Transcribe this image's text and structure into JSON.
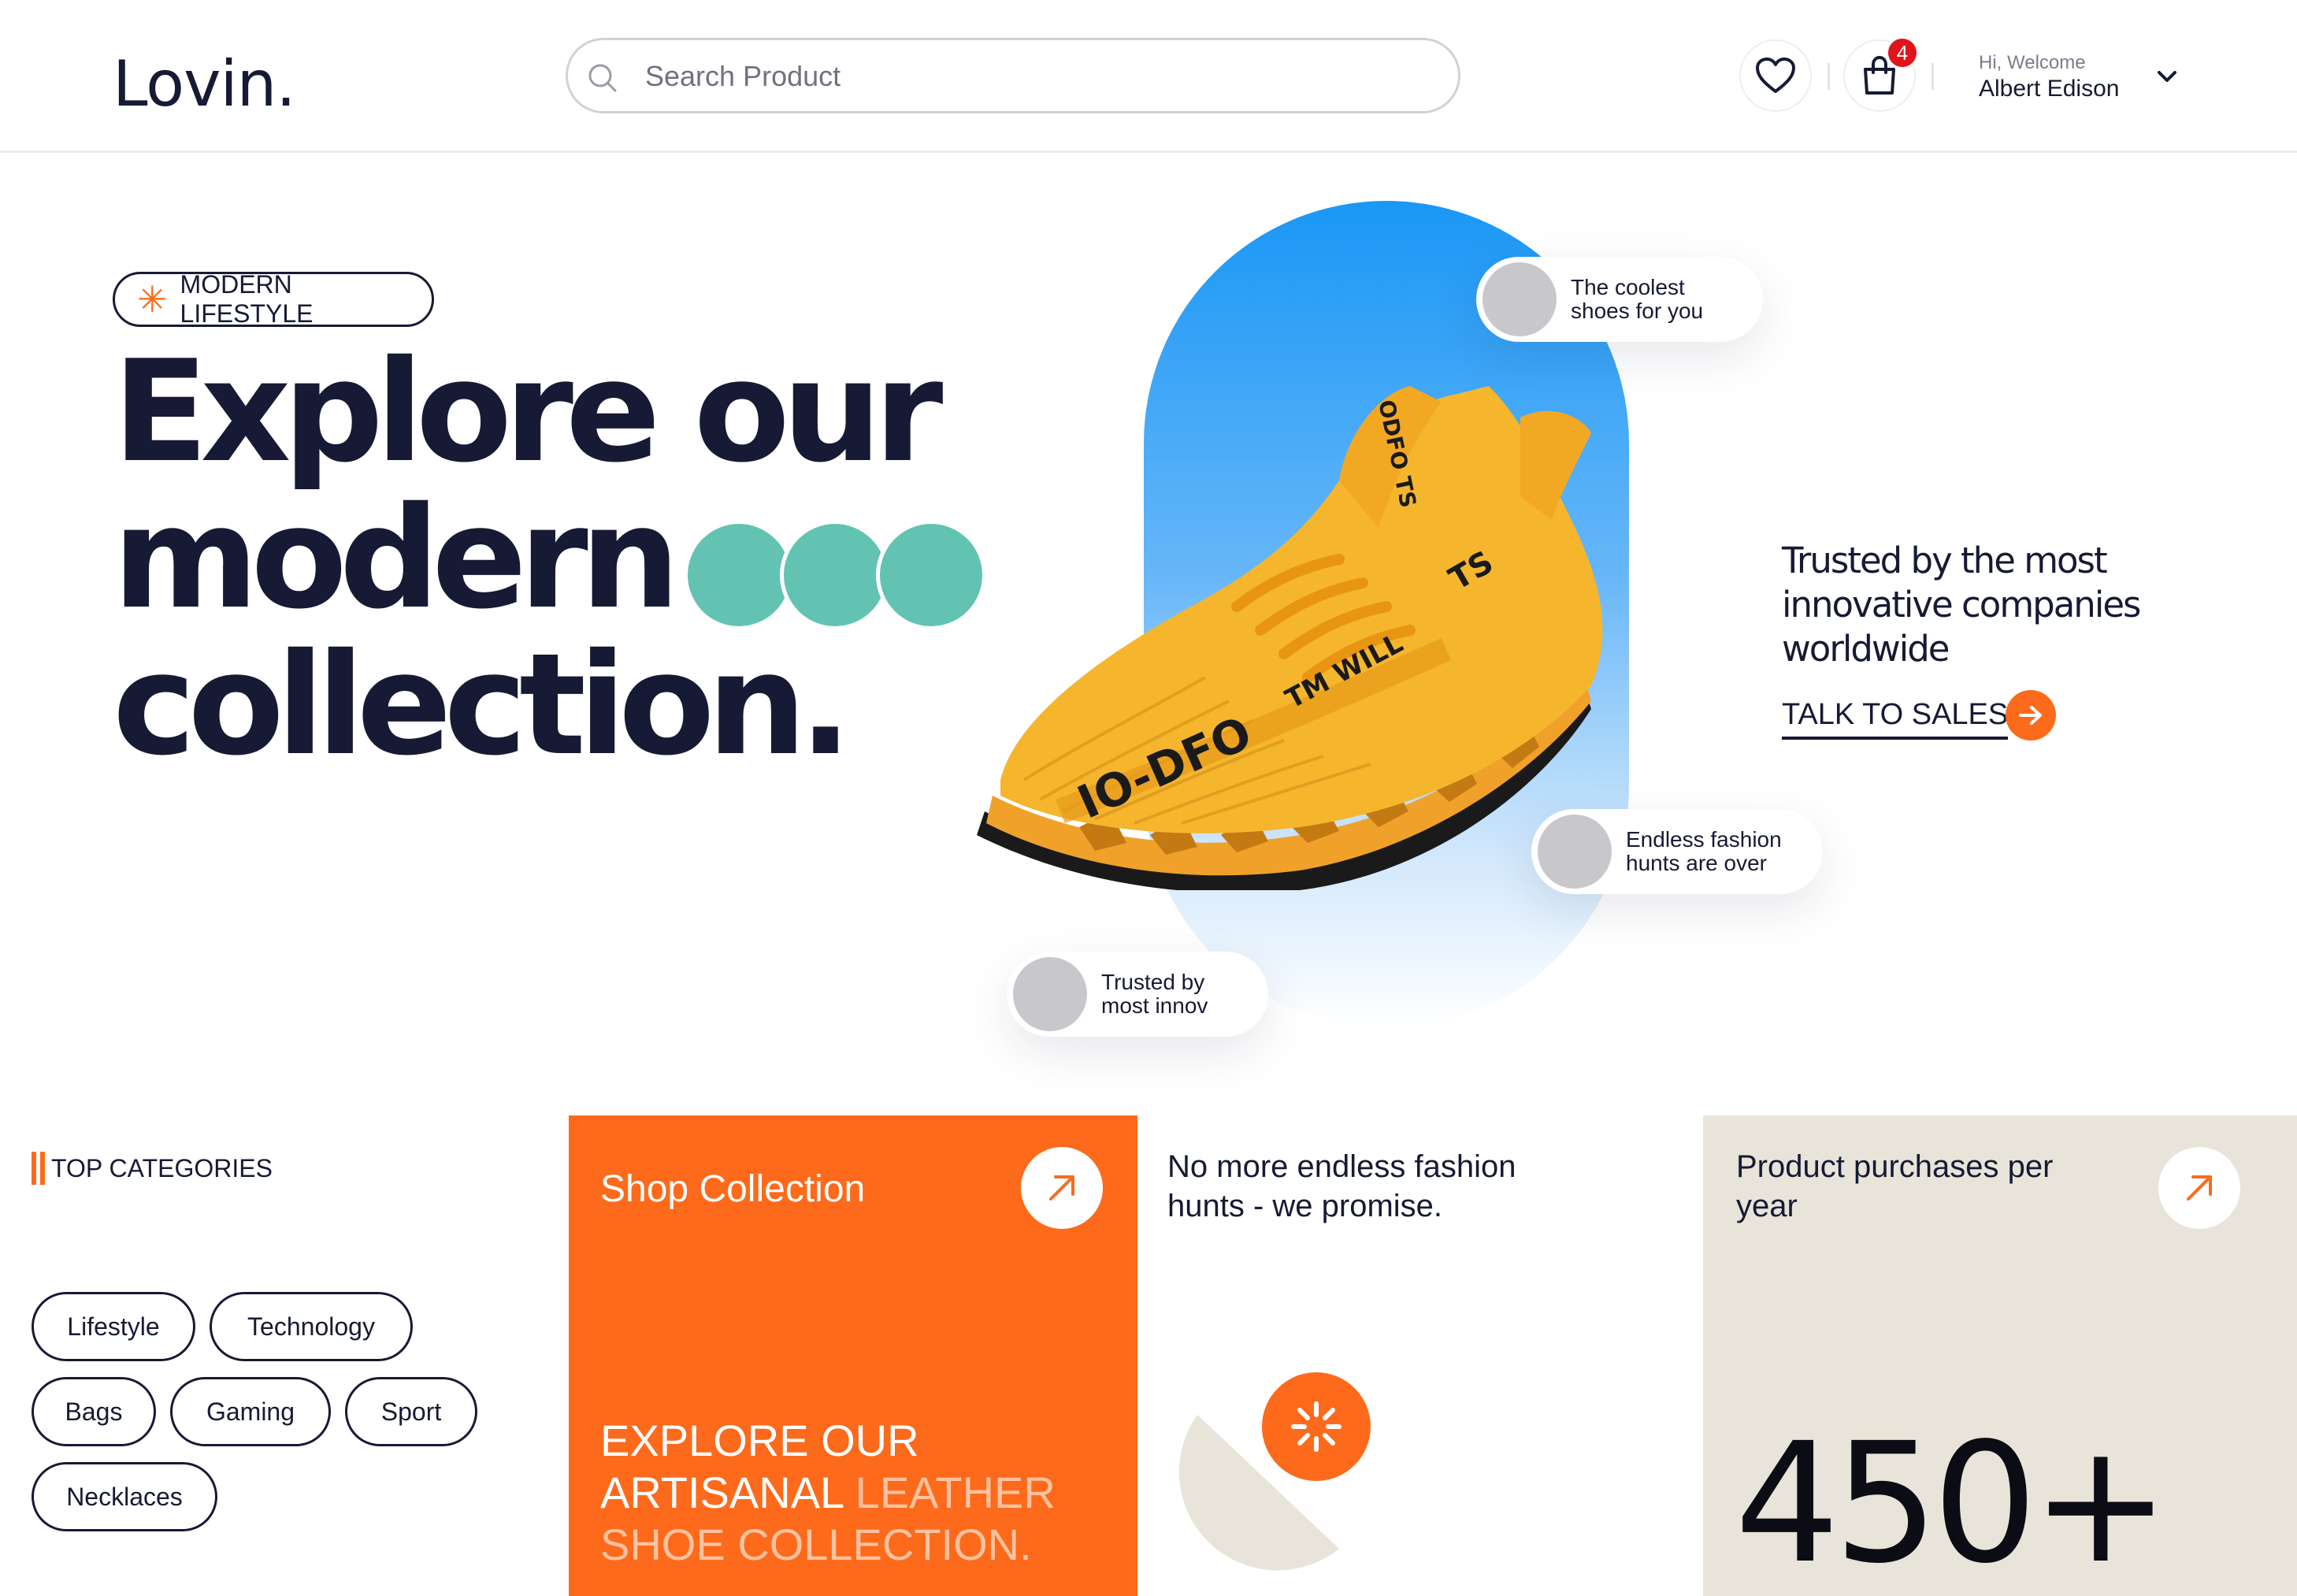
{
  "header": {
    "logo": "Lovin.",
    "search_placeholder": "Search Product",
    "cart_count": "4",
    "welcome_small": "Hi, Welcome",
    "user_name": "Albert Edison",
    "icons": [
      "search-icon",
      "heart-icon",
      "shopping-bag-icon",
      "chevron-down-icon"
    ]
  },
  "hero": {
    "tag": "MODERN LIFESTYLE",
    "title_lines": [
      "Explore our",
      "modern",
      "collection."
    ],
    "dot_color": "#63c3b2",
    "capsule_color": "#1a97f5",
    "bubbles": [
      "The coolest shoes for you",
      "Endless fashion hunts are over",
      "Trusted by most innov"
    ],
    "trusted": "Trusted by the most innovative companies worldwide",
    "cta": "TALK TO SALES",
    "accent": "#fb6b1b"
  },
  "categories": {
    "heading": "TOP CATEGORIES",
    "items": [
      "Lifestyle",
      "Technology",
      "Bags",
      "Gaming",
      "Sport",
      "Necklaces"
    ]
  },
  "cards": {
    "shop": {
      "title": "Shop Collection",
      "explore_line1": "EXPLORE OUR",
      "explore_line2a": "ARTISANAL ",
      "explore_line2b": "LEATHER",
      "explore_line3": "SHOE COLLECTION.",
      "color": "#fd6a1b"
    },
    "promise": {
      "title": "No more endless fashion hunts - we promise."
    },
    "purchases": {
      "title": "Product purchases per year",
      "value": "450+",
      "color": "#e8e4d9"
    }
  }
}
